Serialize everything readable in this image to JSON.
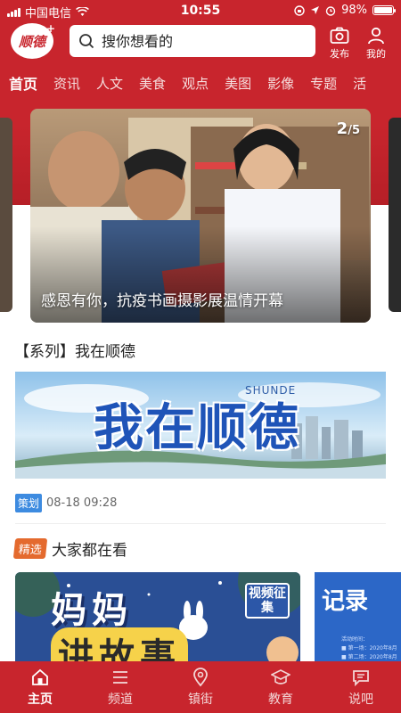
{
  "status_bar": {
    "carrier": "中国电信",
    "time": "10:55",
    "battery": "98%",
    "battery_level": 0.98
  },
  "header": {
    "logo_text": "顺德",
    "search_placeholder": "搜你想看的",
    "publish_label": "发布",
    "mine_label": "我的"
  },
  "tabs": [
    {
      "label": "首页",
      "active": true
    },
    {
      "label": "资讯"
    },
    {
      "label": "人文"
    },
    {
      "label": "美食"
    },
    {
      "label": "观点"
    },
    {
      "label": "美图"
    },
    {
      "label": "影像"
    },
    {
      "label": "专题"
    },
    {
      "label": "活"
    }
  ],
  "carousel": {
    "current": "2",
    "total": "/5",
    "caption": "感恩有你，抗疫书画摄影展温情开幕"
  },
  "series": {
    "title": "【系列】我在顺德",
    "banner_text": "我在顺德",
    "banner_sub": "SHUNDE",
    "badge": "策划",
    "datetime": "08-18 09:28"
  },
  "featured": {
    "tag": "精选",
    "title": "大家都在看",
    "card1": {
      "line1": "妈妈",
      "line2": "讲故事",
      "video_tag": "视频征集"
    },
    "card2": {
      "title": "记录",
      "line1": "活动时间：",
      "line2": "■ 第一场：2020年8月",
      "line3": "■ 第二场：2020年8月"
    }
  },
  "bottom_nav": [
    {
      "label": "主页",
      "icon": "home-icon",
      "active": true
    },
    {
      "label": "频道",
      "icon": "list-icon"
    },
    {
      "label": "镇街",
      "icon": "location-icon"
    },
    {
      "label": "教育",
      "icon": "graduation-icon"
    },
    {
      "label": "说吧",
      "icon": "chat-icon"
    }
  ],
  "colors": {
    "brand": "#c8252d",
    "badge_blue": "#3d8be0",
    "pick_orange": "#e46a2e"
  }
}
